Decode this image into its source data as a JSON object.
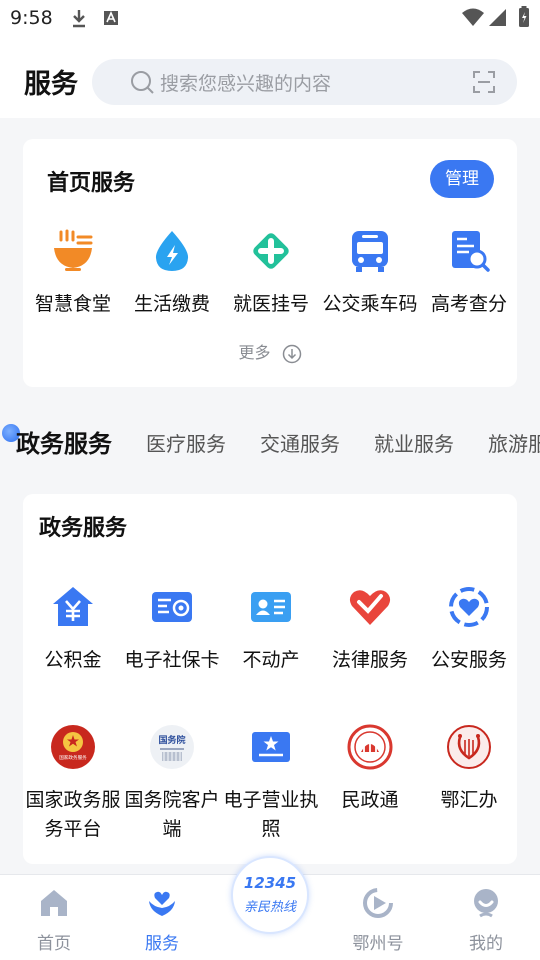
{
  "status_bar": {
    "time": "9:58"
  },
  "header": {
    "title": "服务",
    "search_placeholder": "搜索您感兴趣的内容"
  },
  "home_services": {
    "title": "首页服务",
    "manage_label": "管理",
    "items": [
      {
        "label": "智慧食堂",
        "icon": "canteen-bowl-icon"
      },
      {
        "label": "生活缴费",
        "icon": "utility-payment-icon"
      },
      {
        "label": "就医挂号",
        "icon": "medical-cross-icon"
      },
      {
        "label": "公交乘车码",
        "icon": "bus-icon"
      },
      {
        "label": "高考查分",
        "icon": "exam-score-search-icon"
      }
    ],
    "more_label": "更多"
  },
  "category_tabs": [
    "政务服务",
    "医疗服务",
    "交通服务",
    "就业服务",
    "旅游服"
  ],
  "gov_services": {
    "title": "政务服务",
    "row1": [
      {
        "label": "公积金",
        "icon": "housing-fund-icon"
      },
      {
        "label": "电子社保卡",
        "icon": "social-security-card-icon"
      },
      {
        "label": "不动产",
        "icon": "property-id-card-icon"
      },
      {
        "label": "法律服务",
        "icon": "legal-heart-icon"
      },
      {
        "label": "公安服务",
        "icon": "police-shield-icon"
      }
    ],
    "row2": [
      {
        "label": "国家政务服务平台",
        "icon": "national-emblem-icon",
        "emblem_text": "国家政务服务"
      },
      {
        "label": "国务院客户端",
        "icon": "state-council-logo-icon",
        "logo_text": "国务院"
      },
      {
        "label": "电子营业执照",
        "icon": "business-license-icon"
      },
      {
        "label": "民政通",
        "icon": "civil-affairs-seal-icon"
      },
      {
        "label": "鄂汇办",
        "icon": "ehuiban-lyre-icon"
      }
    ]
  },
  "bottom_nav": {
    "items": [
      {
        "label": "首页",
        "icon": "home-icon"
      },
      {
        "label": "服务",
        "icon": "service-heart-hands-icon"
      },
      {
        "label": "鄂州号",
        "icon": "play-circle-icon"
      },
      {
        "label": "我的",
        "icon": "user-icon"
      }
    ],
    "hotline_number": "12345",
    "hotline_text": "亲民热线"
  },
  "colors": {
    "accent": "#3a78f2",
    "orange": "#f28a26",
    "red": "#e9453c",
    "sky": "#2aa3f0"
  }
}
